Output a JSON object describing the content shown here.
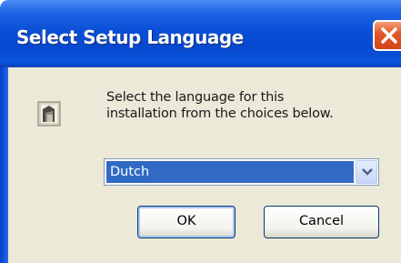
{
  "window": {
    "title": "Select Setup Language"
  },
  "icons": {
    "close": "close-icon",
    "setup": "setup-icon",
    "dropdown": "chevron-down-icon"
  },
  "message": {
    "line1": "Select the language for this",
    "line2": "installation from the choices below."
  },
  "language_select": {
    "selected": "Dutch"
  },
  "buttons": {
    "ok": "OK",
    "cancel": "Cancel"
  },
  "colors": {
    "titlebar": "#0a4fd6",
    "close_button": "#e2582c",
    "selection": "#316ac5",
    "dialog_background": "#ece9d8"
  }
}
